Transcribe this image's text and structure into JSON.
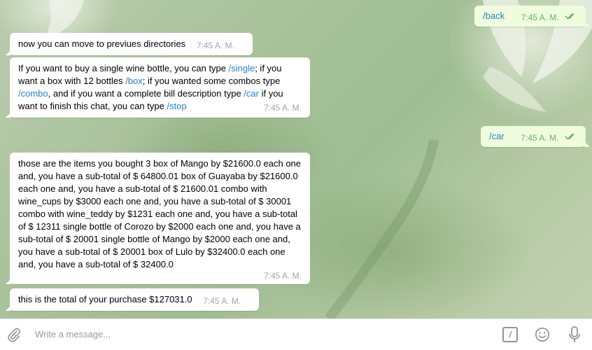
{
  "messages": [
    {
      "dir": "out",
      "text": "/back",
      "time": "7:45 A. M."
    },
    {
      "dir": "in",
      "text": "now you can move to previues directories",
      "time": "7:45 A. M."
    },
    {
      "dir": "in",
      "parts": [
        "If you want to buy a single wine bottle, you can type ",
        "/single",
        "; if you want a box with 12 bottles ",
        "/box",
        "; if you wanted some combos type ",
        "/combo",
        ", and if you want a complete bill description type ",
        "/car",
        " if you want to finish this chat, you can type ",
        "/stop"
      ],
      "time": "7:45 A. M."
    },
    {
      "dir": "out",
      "text": "/car",
      "time": "7:45 A. M."
    },
    {
      "dir": "in",
      "text": "those are the items you bought 3 box of Mango by $21600.0 each one and, you have a sub-total of $ 64800.01 box of Guayaba by $21600.0 each one and, you have a sub-total of $ 21600.01 combo with wine_cups by $3000 each one and, you have a sub-total of $ 30001 combo with wine_teddy by $1231 each one and, you have a sub-total of $ 12311 single bottle of Corozo by $2000 each one and, you have a sub-total of $ 20001 single bottle of Mango by $2000 each one and, you have a sub-total of $ 20001 box of Lulo by $32400.0 each one and, you have a sub-total of $ 32400.0",
      "time": "7:45 A. M."
    },
    {
      "dir": "in",
      "text": "this is the total of your purchase $127031.0",
      "time": "7:45 A. M."
    }
  ],
  "composer": {
    "placeholder": "Write a message...",
    "attach_icon": "paperclip-icon",
    "command_icon": "slash-command-icon",
    "command_glyph": "/",
    "emoji_icon": "smiley-icon",
    "mic_icon": "microphone-icon"
  },
  "colors": {
    "incoming_bubble": "#ffffff",
    "outgoing_bubble": "#effdde",
    "link": "#2481cc",
    "outgoing_time": "#6cb165",
    "incoming_time": "#a3a3a3"
  }
}
